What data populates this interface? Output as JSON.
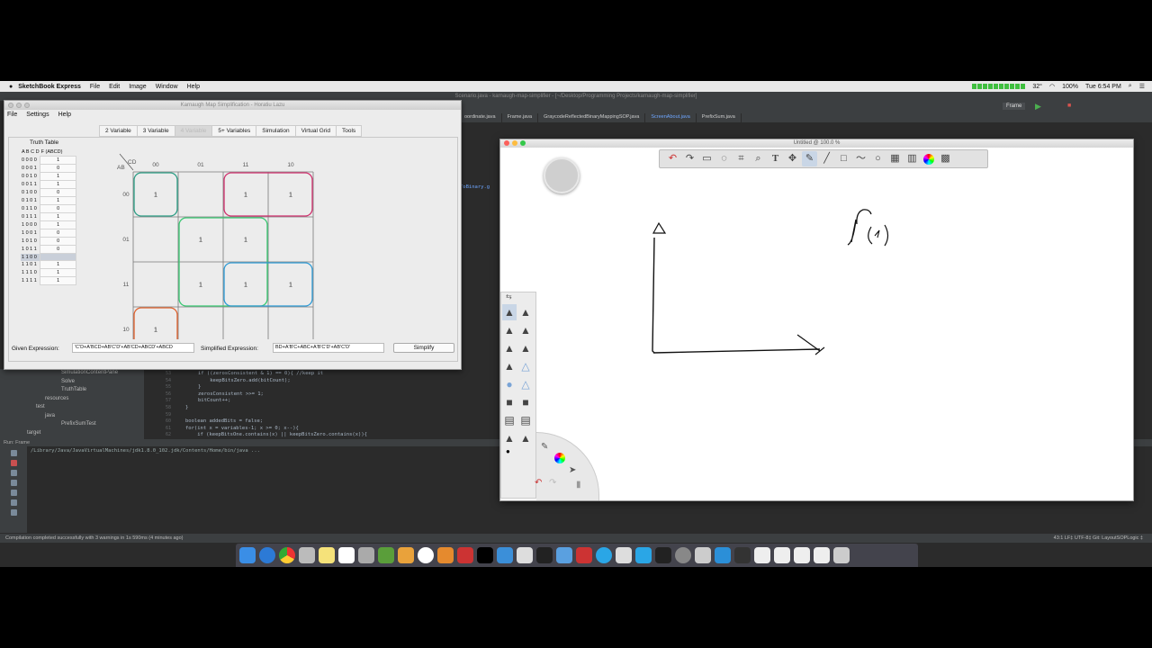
{
  "menubar": {
    "app_name": "SketchBook Express",
    "items": [
      "File",
      "Edit",
      "Image",
      "Window",
      "Help"
    ],
    "temperature": "32°",
    "battery": "100%",
    "clock": "Tue 6:54 PM"
  },
  "ide": {
    "title": "Scenario.java - karnaugh-map-simplifier - [~/Desktop/Programming Projects/karnaugh-map-simplifier]",
    "tabs": [
      {
        "label": "oordinate.java",
        "active": false
      },
      {
        "label": "Frame.java",
        "active": false
      },
      {
        "label": "GraycodeReflectedBinaryMappingSOP.java",
        "active": false
      },
      {
        "label": "ScreenAbout.java",
        "active": true
      },
      {
        "label": "PrefixSum.java",
        "active": false
      }
    ],
    "run_config": "Frame",
    "side_snippet": "ToBinary.g",
    "project_tree": [
      "SimulationContentPane",
      "Solve",
      "TruthTable",
      "resources",
      "test",
      "java",
      "PrefixSumTest",
      "target"
    ],
    "gutter": [
      "53",
      "54",
      "55",
      "56",
      "57",
      "58",
      "59",
      "60",
      "61",
      "62",
      "63",
      "64"
    ],
    "code_lines": [
      "if ((zerosConsistent & 1) == 0){ //keep it",
      "    keepBitsZero.add(bitCount);",
      "}",
      "zerosConsistent >>= 1;",
      "bitCount++;",
      "}",
      "",
      "boolean addedBits = false;",
      "for(int x = variables-1; x >= 0; x--){",
      "    if (keepBitsOne.contains(x) || keepBitsZero.contains(x)){"
    ],
    "run_header": "Run:   Frame",
    "run_output": "/Library/Java/JavaVirtualMachines/jdk1.8.0_102.jdk/Contents/Home/bin/java ...",
    "status_left": "Compilation completed successfully with 3 warnings in 1s 590ms (4 minutes ago)",
    "status_right": "43:1   LF‡   UTF-8‡   Git: LayoutSOPLogic ‡"
  },
  "kmap_window": {
    "title": "Karnaugh Map Simplification - Horatiu Lazu",
    "menu": [
      "File",
      "Settings",
      "Help"
    ],
    "tabs": [
      {
        "label": "2 Variable",
        "selected": false
      },
      {
        "label": "3 Variable",
        "selected": false
      },
      {
        "label": "4 Variable",
        "selected": true
      },
      {
        "label": "5+ Variables",
        "selected": false
      },
      {
        "label": "Simulation",
        "selected": false
      },
      {
        "label": "Virtual Grid",
        "selected": false
      },
      {
        "label": "Tools",
        "selected": false
      }
    ],
    "truth_table": {
      "title": "Truth Table",
      "header": [
        "A",
        "B",
        "C",
        "D",
        "F (ABCD)"
      ],
      "rows": [
        {
          "bits": "0 0 0 0",
          "f": "1"
        },
        {
          "bits": "0 0 0 1",
          "f": "0"
        },
        {
          "bits": "0 0 1 0",
          "f": "1"
        },
        {
          "bits": "0 0 1 1",
          "f": "1"
        },
        {
          "bits": "0 1 0 0",
          "f": "0"
        },
        {
          "bits": "0 1 0 1",
          "f": "1"
        },
        {
          "bits": "0 1 1 0",
          "f": "0"
        },
        {
          "bits": "0 1 1 1",
          "f": "1"
        },
        {
          "bits": "1 0 0 0",
          "f": "1"
        },
        {
          "bits": "1 0 0 1",
          "f": "0"
        },
        {
          "bits": "1 0 1 0",
          "f": "0"
        },
        {
          "bits": "1 0 1 1",
          "f": "0"
        },
        {
          "bits": "1 1 0 0",
          "f": ""
        },
        {
          "bits": "1 1 0 1",
          "f": "1"
        },
        {
          "bits": "1 1 1 0",
          "f": "1"
        },
        {
          "bits": "1 1 1 1",
          "f": "1"
        }
      ],
      "highlighted_row": 12
    },
    "kmap": {
      "corner_cd": "CD",
      "corner_ab": "AB",
      "col_headers": [
        "00",
        "01",
        "11",
        "10"
      ],
      "row_headers": [
        "00",
        "01",
        "11",
        "10"
      ],
      "cells": [
        [
          "1",
          "",
          "1",
          "1"
        ],
        [
          "",
          "1",
          "1",
          ""
        ],
        [
          "",
          "1",
          "1",
          "1"
        ],
        [
          "1",
          "",
          "",
          ""
        ]
      ],
      "group_colors": {
        "teal": "#2e9e86",
        "magenta": "#d0306e",
        "green": "#38c872",
        "blue": "#2e9bd6",
        "orange": "#e0622e"
      }
    },
    "given_label": "Given Expression:",
    "given_value": "'C'D+A'BCD+AB'C'D'+AB'CD+ABCD'+ABCD",
    "simplified_label": "Simplified Expression:",
    "simplified_value": "BD+A'B'C+ABC+A'B'C'D'+AB'C'D'",
    "simplify_button": "Simplify"
  },
  "sketch_window": {
    "title": "Untitled @ 100.0 %",
    "toolbar_icons": [
      "undo-icon",
      "redo-icon",
      "select-rect-icon",
      "lasso-icon",
      "crop-icon",
      "zoom-icon",
      "text-icon",
      "move-icon",
      "pen-icon",
      "line-icon",
      "rect-icon",
      "polyline-icon",
      "ellipse-icon",
      "copic-icon",
      "brush-icon",
      "color-wheel-icon",
      "layers-icon"
    ],
    "puck_color": "#cfcfcf"
  }
}
